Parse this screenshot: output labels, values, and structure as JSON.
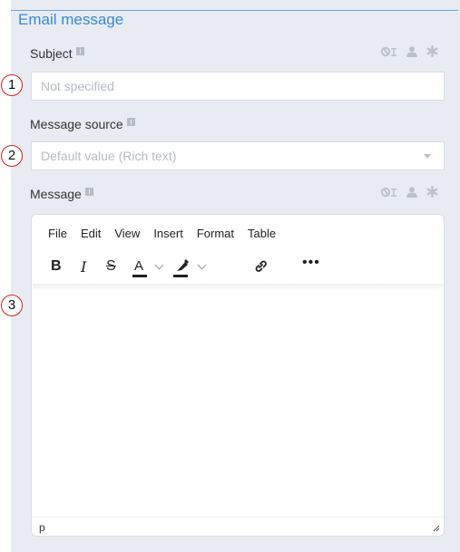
{
  "section": {
    "title": "Email message"
  },
  "subject": {
    "label": "Subject",
    "placeholder": "Not specified",
    "callout": "1"
  },
  "message_source": {
    "label": "Message source",
    "placeholder": "Default value (Rich text)",
    "callout": "2"
  },
  "message": {
    "label": "Message",
    "callout": "3",
    "editor": {
      "menu": [
        "File",
        "Edit",
        "View",
        "Insert",
        "Format",
        "Table"
      ],
      "toolbar": {
        "bold": "B",
        "italic": "I",
        "strike": "S",
        "text_color": "A",
        "more": "•••"
      },
      "status_path": "p"
    }
  },
  "icons": [
    "info-icon",
    "lock-text-icon",
    "user-icon",
    "asterisk-icon",
    "chevron-down-icon",
    "link-icon",
    "highlighter-icon",
    "resize-handle-icon"
  ],
  "colors": {
    "accent": "#3b87d6",
    "callout": "#d42020",
    "panel": "#e8ecf2"
  }
}
